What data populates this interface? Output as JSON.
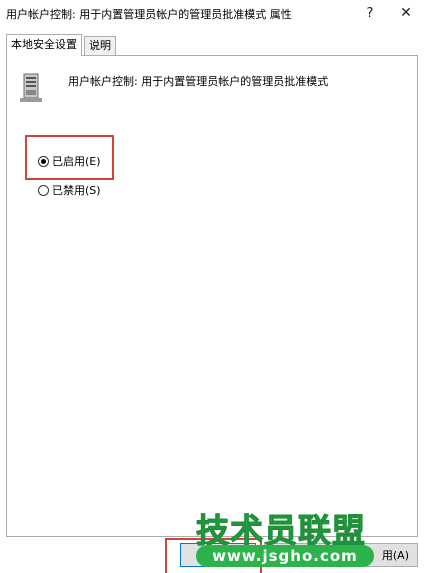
{
  "window": {
    "title": "用户帐户控制: 用于内置管理员帐户的管理员批准模式 属性",
    "help_glyph": "?",
    "close_glyph": "✕"
  },
  "tabs": [
    {
      "label": "本地安全设置",
      "active": true
    },
    {
      "label": "说明",
      "active": false
    }
  ],
  "policy": {
    "icon": "server-icon",
    "title": "用户帐户控制: 用于内置管理员帐户的管理员批准模式"
  },
  "options": {
    "enabled": {
      "label": "已启用(E)",
      "checked": true
    },
    "disabled": {
      "label": "已禁用(S)",
      "checked": false
    }
  },
  "footer": {
    "ok_label": "",
    "cancel_label": "",
    "apply_label": "用(A)"
  },
  "watermark": {
    "title": "技术员联盟",
    "url": "www.jsgho.com"
  },
  "colors": {
    "highlight_box": "#d8413b",
    "watermark_green": "#28b24a",
    "focus_blue": "#0078d7"
  }
}
